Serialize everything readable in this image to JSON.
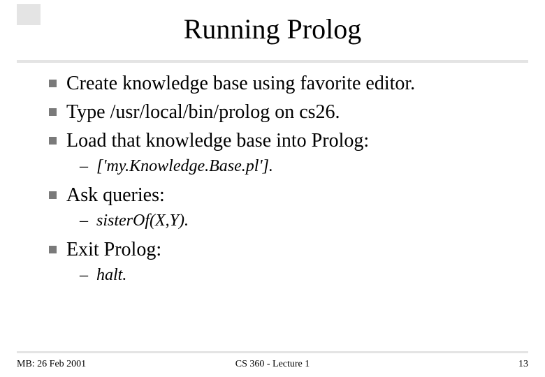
{
  "title": "Running Prolog",
  "bullets": {
    "b1": "Create knowledge base using favorite editor.",
    "b2_pre": "Type ",
    "b2_code": "/usr/local/bin/prolog",
    "b2_post": " on cs26.",
    "b3": "Load that knowledge base into Prolog:",
    "s3": "['my.Knowledge.Base.pl'].",
    "b4": "Ask queries:",
    "s4": "sisterOf(X,Y).",
    "b5": "Exit Prolog:",
    "s5": "halt."
  },
  "footer": {
    "left": "MB: 26 Feb 2001",
    "center": "CS 360 - Lecture 1",
    "right": "13"
  }
}
